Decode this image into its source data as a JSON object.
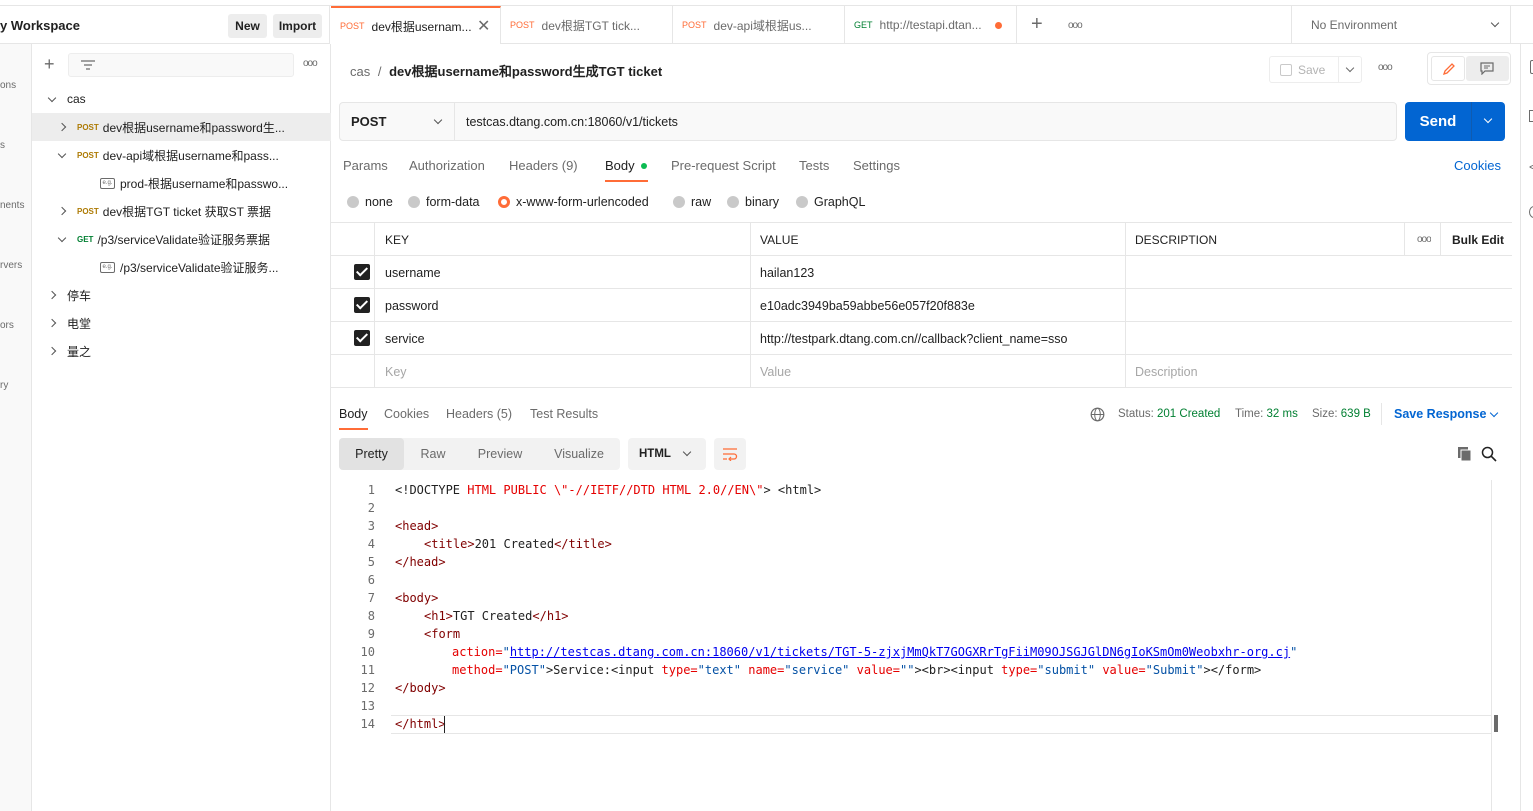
{
  "workspace": {
    "title": "y Workspace",
    "new_label": "New",
    "import_label": "Import"
  },
  "rail": {
    "items": [
      "ons",
      "s",
      "nents",
      "rvers",
      "ors",
      "ry"
    ]
  },
  "sidebar": {
    "tree": [
      {
        "label": "cas",
        "type": "folder"
      },
      {
        "method": "POST",
        "label": "dev根据username和password生...",
        "type": "request"
      },
      {
        "method": "POST",
        "label": "dev-api域根据username和pass...",
        "type": "request"
      },
      {
        "label": "prod-根据username和passwo...",
        "type": "example"
      },
      {
        "method": "POST",
        "label": "dev根据TGT ticket 获取ST 票据",
        "type": "request"
      },
      {
        "method": "GET",
        "label": "/p3/serviceValidate验证服务票据",
        "type": "request"
      },
      {
        "label": "/p3/serviceValidate验证服务...",
        "type": "example"
      },
      {
        "label": "停车",
        "type": "folder"
      },
      {
        "label": "电堂",
        "type": "folder"
      },
      {
        "label": "量之",
        "type": "folder"
      }
    ],
    "example_badge": "e.g."
  },
  "tabs": [
    {
      "method": "POST",
      "label": "dev根据usernam..."
    },
    {
      "method": "POST",
      "label": "dev根据TGT tick..."
    },
    {
      "method": "POST",
      "label": "dev-api域根据us..."
    },
    {
      "method": "GET",
      "label": "http://testapi.dtan..."
    }
  ],
  "environment": {
    "label": "No Environment"
  },
  "request": {
    "breadcrumb_parent": "cas",
    "breadcrumb_sep": "/",
    "breadcrumb_name": "dev根据username和password生成TGT ticket",
    "save_label": "Save",
    "method": "POST",
    "url": "testcas.dtang.com.cn:18060/v1/tickets",
    "send_label": "Send"
  },
  "request_tabs": [
    "Params",
    "Authorization",
    "Headers (9)",
    "Body",
    "Pre-request Script",
    "Tests",
    "Settings"
  ],
  "cookies_label": "Cookies",
  "body_types": [
    "none",
    "form-data",
    "x-www-form-urlencoded",
    "raw",
    "binary",
    "GraphQL"
  ],
  "params_table": {
    "headers": {
      "key": "KEY",
      "value": "VALUE",
      "description": "DESCRIPTION",
      "bulk_edit": "Bulk Edit"
    },
    "rows": [
      {
        "key": "username",
        "value": "hailan123",
        "description": ""
      },
      {
        "key": "password",
        "value": "e10adc3949ba59abbe56e057f20f883e",
        "description": ""
      },
      {
        "key": "service",
        "value": "http://testpark.dtang.com.cn//callback?client_name=sso",
        "description": ""
      }
    ],
    "placeholders": {
      "key": "Key",
      "value": "Value",
      "description": "Description"
    }
  },
  "response": {
    "tabs": [
      "Body",
      "Cookies",
      "Headers (5)",
      "Test Results"
    ],
    "status_label": "Status:",
    "status_value": "201 Created",
    "time_label": "Time:",
    "time_value": "32 ms",
    "size_label": "Size:",
    "size_value": "639 B",
    "save_label": "Save Response",
    "views": [
      "Pretty",
      "Raw",
      "Preview",
      "Visualize"
    ],
    "format": "HTML",
    "line_numbers": [
      "1",
      "2",
      "3",
      "4",
      "5",
      "6",
      "7",
      "8",
      "9",
      "10",
      "11",
      "12",
      "13",
      "14"
    ],
    "code": {
      "l1_a": "<!DOCTYPE ",
      "l1_b": "HTML PUBLIC \\\"-//IETF//DTD HTML 2.0//EN\\\"",
      "l1_c": "> <html>",
      "l3": "<head>",
      "l4_a": "<title>",
      "l4_b": "201 Created",
      "l4_c": "</title>",
      "l5": "</head>",
      "l7": "<body>",
      "l8_a": "<h1>",
      "l8_b": "TGT Created",
      "l8_c": "</h1>",
      "l9": "<form",
      "l10_attr": "action=",
      "l10_link": "http://testcas.dtang.com.cn:18060/v1/tickets/TGT-5-zjxjMmQkT7GOGXRrTgFiiM09OJSGJGlDN6gIoKSmOm0Weobxhr-org.cj",
      "l11_attr1": "method=",
      "l11_val1": "\"POST\"",
      "l11_text": ">Service:<input ",
      "l11_attr2": "type=",
      "l11_val2": "\"text\"",
      "l11_attr3": "name=",
      "l11_val3": "\"service\"",
      "l11_attr4": "value=",
      "l11_val4": "\"\"",
      "l11_mid": "><br><input ",
      "l11_attr5": "type=",
      "l11_val5": "\"submit\"",
      "l11_attr6": "value=",
      "l11_val6": "\"Submit\"",
      "l11_end": "></form>",
      "l12": "</body>",
      "l14": "</html>"
    }
  },
  "colors": {
    "accent": "#ff6c37",
    "send": "#0265d2",
    "status_ok": "#007f31",
    "post": "#ad7a03",
    "get": "#007f31"
  }
}
